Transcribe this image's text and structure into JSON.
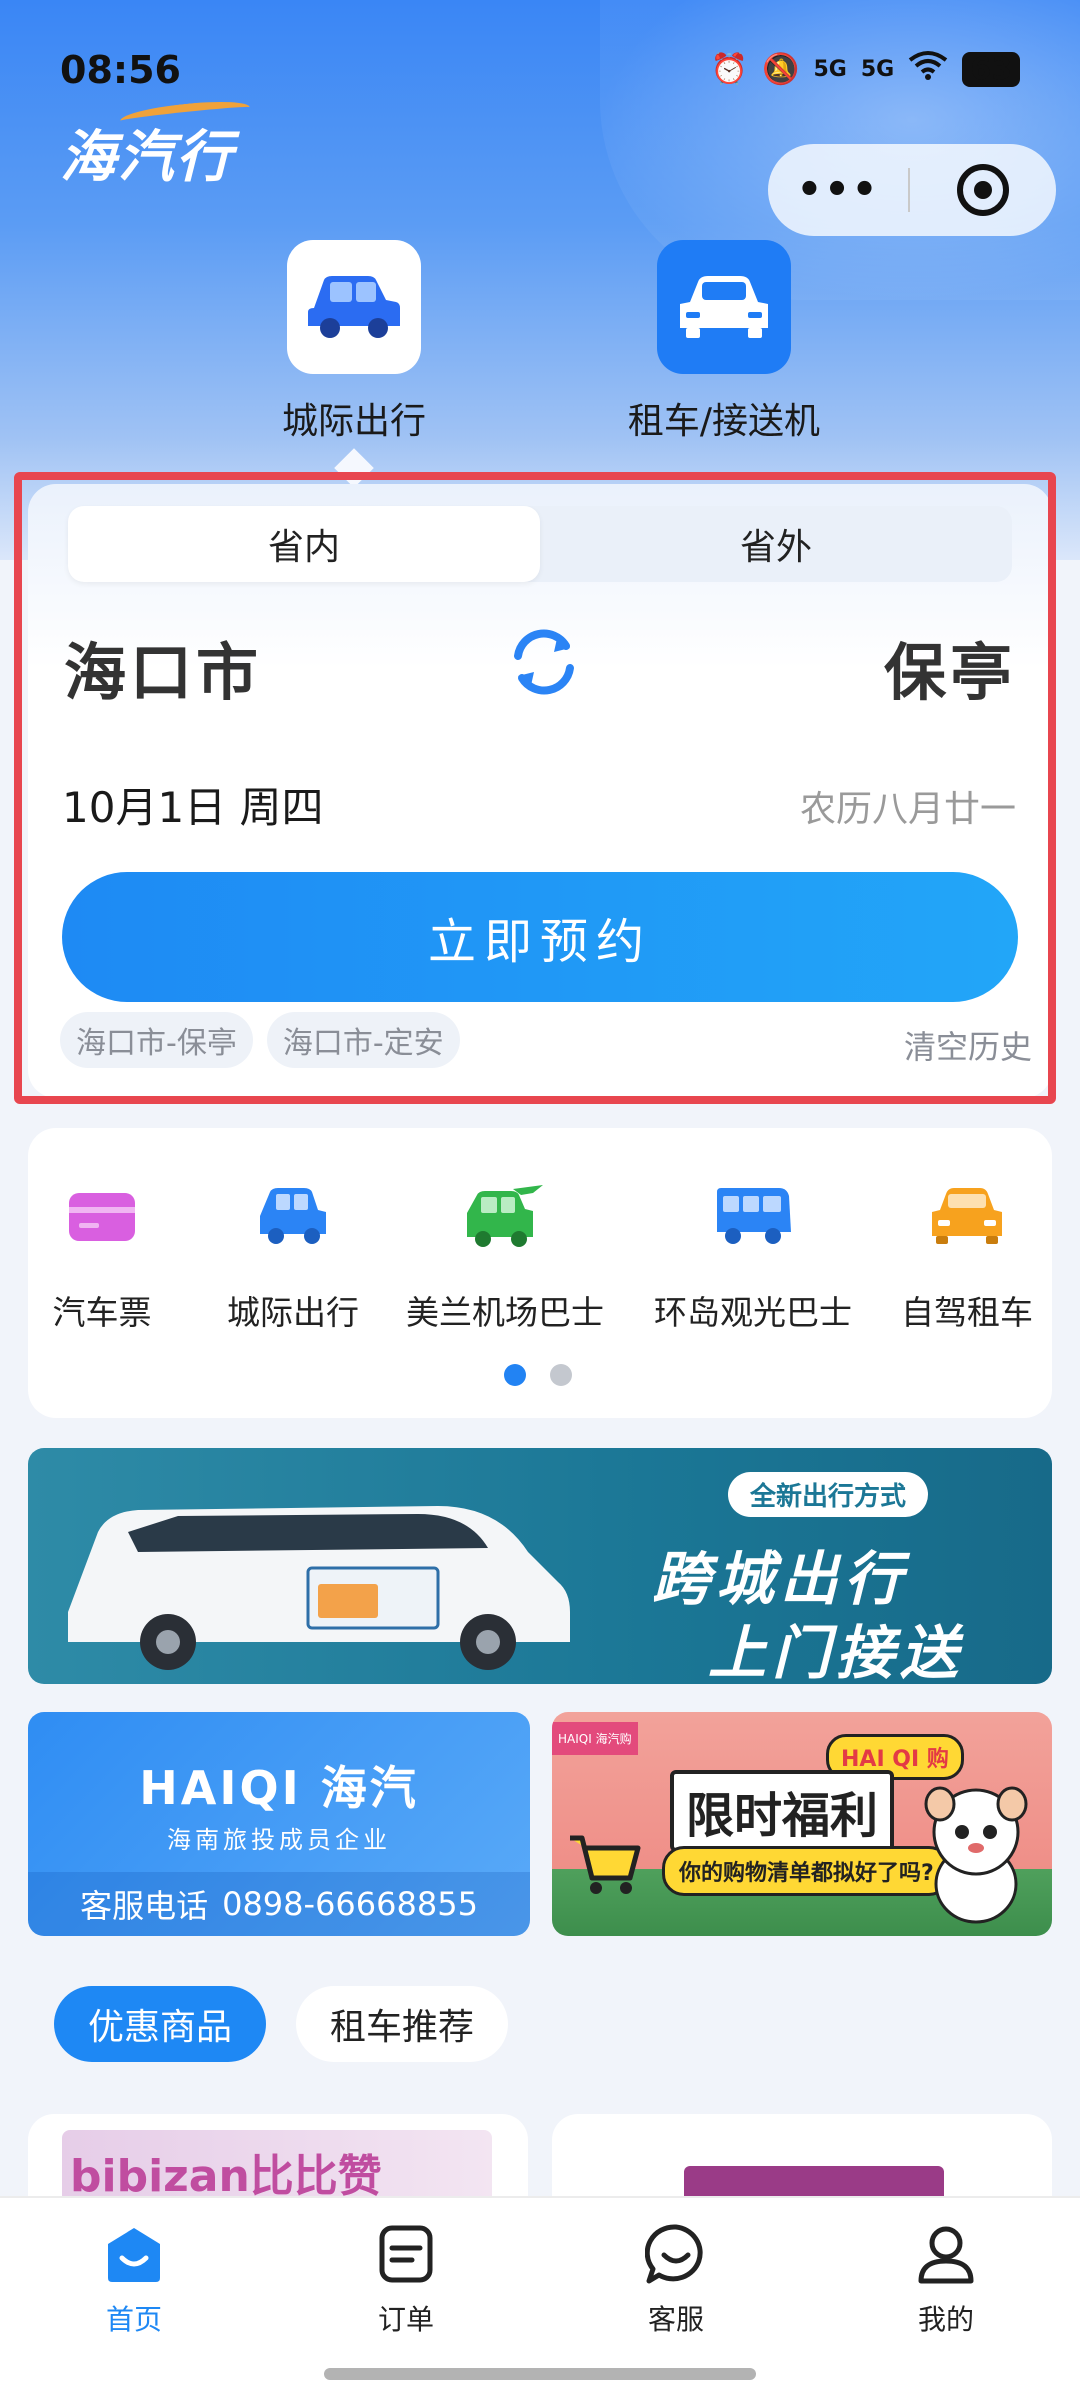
{
  "status_bar": {
    "time": "08:56",
    "signal_1": "5G",
    "signal_2": "5G",
    "battery": "63"
  },
  "header": {
    "logo_text": "海汽行"
  },
  "service_tabs": [
    {
      "label": "城际出行",
      "active": true,
      "icon": "car-icon"
    },
    {
      "label": "租车/接送机",
      "active": false,
      "icon": "sedan-icon"
    }
  ],
  "booking": {
    "segments": [
      {
        "label": "省内",
        "active": true
      },
      {
        "label": "省外",
        "active": false
      }
    ],
    "from_city": "海口市",
    "to_city": "保亭",
    "date": "10月1日 周四",
    "lunar_date": "农历八月廿一",
    "book_button": "立即预约",
    "history": [
      "海口市-保亭",
      "海口市-定安"
    ],
    "clear_history": "清空历史"
  },
  "quick_entries": [
    {
      "label": "汽车票",
      "icon": "ticket-icon",
      "color": "#d95fe0"
    },
    {
      "label": "城际出行",
      "icon": "car-icon",
      "color": "#2b84f5"
    },
    {
      "label": "美兰机场巴士",
      "icon": "airport-bus-icon",
      "color": "#32b64b"
    },
    {
      "label": "环岛观光巴士",
      "icon": "bus-icon",
      "color": "#2b84f5"
    },
    {
      "label": "自驾租车",
      "icon": "rental-car-icon",
      "color": "#f7a21e"
    }
  ],
  "banners": {
    "main": {
      "tag": "全新出行方式",
      "line1": "跨城出行",
      "line2": "上门接送"
    },
    "company": {
      "brand": "HAIQI 海汽",
      "subtitle": "海南旅投成员企业",
      "phone_label": "客服电话",
      "phone": "0898-66668855"
    },
    "promo": {
      "corner_tag": "HAIQI 海汽购",
      "badge": "HAI QI 购",
      "title": "限时福利",
      "subtitle": "你的购物清单都拟好了吗?"
    }
  },
  "promo_tabs": [
    {
      "label": "优惠商品",
      "active": true
    },
    {
      "label": "租车推荐",
      "active": false
    }
  ],
  "products": [
    {
      "brand_text": "bibizan比比赞"
    },
    {
      "brand_text": ""
    }
  ],
  "tabbar": [
    {
      "label": "首页",
      "active": true,
      "icon": "home-icon"
    },
    {
      "label": "订单",
      "active": false,
      "icon": "order-icon"
    },
    {
      "label": "客服",
      "active": false,
      "icon": "chat-icon"
    },
    {
      "label": "我的",
      "active": false,
      "icon": "user-icon"
    }
  ],
  "colors": {
    "primary": "#1e88f4",
    "highlight_border": "#e8464f"
  }
}
